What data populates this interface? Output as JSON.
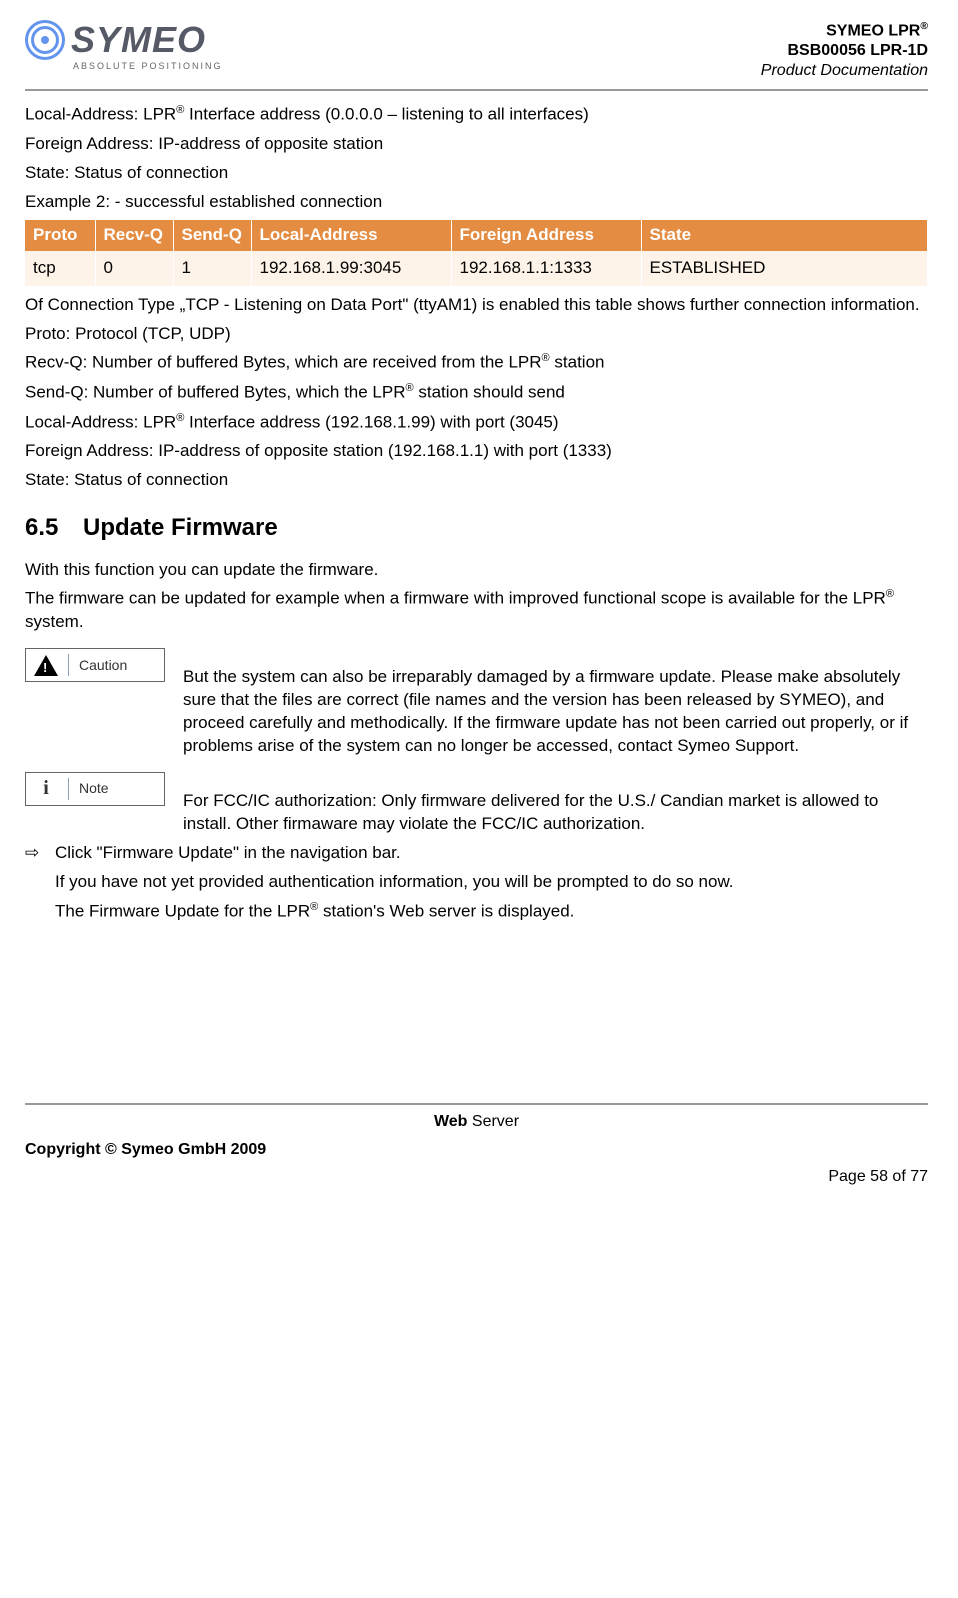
{
  "header": {
    "logo_name": "SYMEO",
    "logo_sub": "ABSOLUTE POSITIONING",
    "right_line1_pre": "SYMEO LPR",
    "right_line2": "BSB00056 LPR-1D",
    "right_line3": "Product Documentation"
  },
  "intro": {
    "p1_pre": "Local-Address: LPR",
    "p1_post": " Interface address (0.0.0.0 – listening to all interfaces)",
    "p2": "Foreign Address: IP-address of opposite station",
    "p3": "State: Status of connection",
    "p4": "Example 2: - successful established connection"
  },
  "table": {
    "headers": {
      "proto": "Proto",
      "recvq": "Recv-Q",
      "sendq": "Send-Q",
      "local": "Local-Address",
      "foreign": "Foreign Address",
      "state": "State"
    },
    "row": {
      "proto": "tcp",
      "recvq": "0",
      "sendq": "1",
      "local": "192.168.1.99:3045",
      "foreign": "192.168.1.1:1333",
      "state": "ESTABLISHED"
    }
  },
  "after_table": {
    "p1": "Of Connection Type „TCP - Listening on Data Port\" (ttyAM1) is enabled this table shows further connection information.",
    "p2": "Proto: Protocol (TCP, UDP)",
    "p3_pre": "Recv-Q: Number of buffered Bytes, which are received from the LPR",
    "p3_post": " station",
    "p4_pre": "Send-Q: Number of buffered Bytes, which the LPR",
    "p4_post": " station should send",
    "p5_pre": "Local-Address: LPR",
    "p5_post": " Interface address (192.168.1.99) with port (3045)",
    "p6": "Foreign Address: IP-address of opposite station (192.168.1.1) with port (1333)",
    "p7": "State: Status of connection"
  },
  "section": {
    "num": "6.5",
    "title": "Update Firmware",
    "p1": "With this function you can update the firmware.",
    "p2_pre": "The firmware can be updated for example when a firmware with improved functional scope is available for the LPR",
    "p2_post": " system."
  },
  "caution": {
    "label": "Caution",
    "body": "But the system can also be irreparably damaged by a firmware update. Please make absolutely sure that the files are correct (file names and the version has been released by SYMEO), and proceed carefully and methodically. If the firmware update has not been carried out properly, or if problems arise of the system can no longer be accessed, contact Symeo Support."
  },
  "note": {
    "label": "Note",
    "body": "For FCC/IC authorization: Only firmware delivered for the U.S./ Candian market is allowed to install. Other firmaware may violate the FCC/IC authorization."
  },
  "steps": {
    "arrow": "⇨",
    "s1": "Click \"Firmware Update\" in the navigation bar.",
    "s2": "If you have not yet provided authentication information, you will be prompted to do so now.",
    "s3_pre": "The Firmware Update for the LPR",
    "s3_post": " station's Web server is displayed."
  },
  "footer": {
    "section_b": "Web",
    "section_r": " Server",
    "copyright": "Copyright © Symeo GmbH 2009",
    "page": "Page 58 of 77"
  },
  "reg": "®"
}
